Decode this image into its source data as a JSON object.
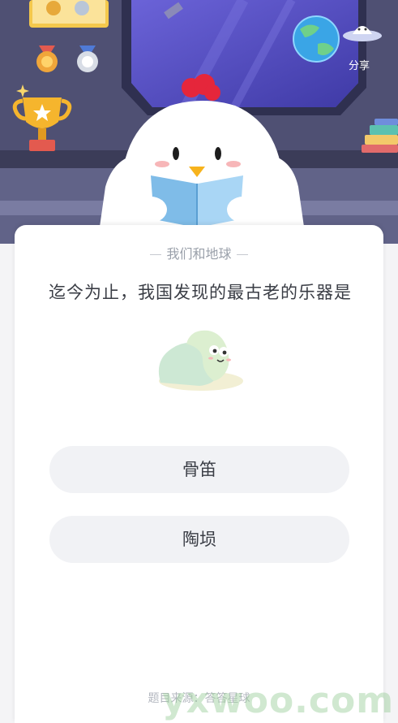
{
  "header": {
    "share_label": "分享"
  },
  "quiz": {
    "category": "我们和地球",
    "question": "迄今为止，我国发现的最古老的乐器是",
    "options": [
      {
        "label": "骨笛"
      },
      {
        "label": "陶埙"
      }
    ],
    "source": "题目来源：答答星球"
  },
  "watermark": {
    "text": "yxwoo.com"
  },
  "icons": {
    "trophy": "trophy-icon",
    "medals": "medal-icon",
    "earth": "earth-icon",
    "ufo": "ufo-icon",
    "mascot": "chick-mascot",
    "snail": "snail-mascot"
  },
  "colors": {
    "hero_bg": "#4a4a6c",
    "card_bg": "#ffffff",
    "option_bg": "#f1f2f5",
    "text": "#3a3d45",
    "muted": "#9aa0aa"
  }
}
